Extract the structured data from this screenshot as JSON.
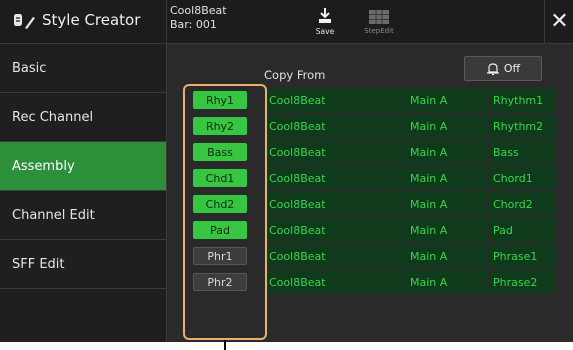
{
  "header": {
    "title": "Style Creator",
    "song_name": "Cool8Beat",
    "bar": "Bar: 001",
    "save_label": "Save",
    "stepedit_label": "StepEdit",
    "close_symbol": "✕"
  },
  "sidebar": {
    "items": [
      {
        "label": "Basic",
        "active": false
      },
      {
        "label": "Rec Channel",
        "active": false
      },
      {
        "label": "Assembly",
        "active": true
      },
      {
        "label": "Channel Edit",
        "active": false
      },
      {
        "label": "SFF Edit",
        "active": false
      }
    ]
  },
  "main": {
    "copy_from_label": "Copy From",
    "off_button_label": "Off",
    "rows": [
      {
        "channel": "Rhy1",
        "enabled": true,
        "style": "Cool8Beat",
        "section": "Main A",
        "part": "Rhythm1"
      },
      {
        "channel": "Rhy2",
        "enabled": true,
        "style": "Cool8Beat",
        "section": "Main A",
        "part": "Rhythm2"
      },
      {
        "channel": "Bass",
        "enabled": true,
        "style": "Cool8Beat",
        "section": "Main A",
        "part": "Bass"
      },
      {
        "channel": "Chd1",
        "enabled": true,
        "style": "Cool8Beat",
        "section": "Main A",
        "part": "Chord1"
      },
      {
        "channel": "Chd2",
        "enabled": true,
        "style": "Cool8Beat",
        "section": "Main A",
        "part": "Chord2"
      },
      {
        "channel": "Pad",
        "enabled": true,
        "style": "Cool8Beat",
        "section": "Main A",
        "part": "Pad"
      },
      {
        "channel": "Phr1",
        "enabled": false,
        "style": "Cool8Beat",
        "section": "Main A",
        "part": "Phrase1"
      },
      {
        "channel": "Phr2",
        "enabled": false,
        "style": "Cool8Beat",
        "section": "Main A",
        "part": "Phrase2"
      }
    ]
  },
  "colors": {
    "accent_green": "#37c642",
    "active_sidebar": "#2c8f3a",
    "cell_text": "#3ad64a",
    "highlight_border": "#e8b06a"
  }
}
